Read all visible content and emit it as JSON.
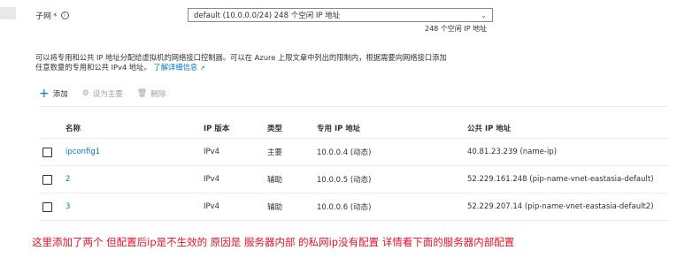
{
  "subnet": {
    "label": "子网",
    "required_mark": "*",
    "value": "default (10.0.0.0/24) 248 个空闲 IP 地址",
    "sub_text": "248 个空闲 IP 地址"
  },
  "description": {
    "line1": "可以将专用和公共 IP 地址分配给虚拟机的网络接口控制器。可以在 Azure 上限文章中列出的限制内，根据需要向网络接口添加",
    "line2": "任意数量的专用和公共 IPv4 地址。",
    "link": "了解详细信息"
  },
  "toolbar": {
    "add": "添加",
    "set_primary": "设为主要",
    "delete": "删除"
  },
  "table": {
    "headers": [
      "名称",
      "IP 版本",
      "类型",
      "专用 IP 地址",
      "公共 IP 地址"
    ],
    "rows": [
      {
        "name": "ipconfig1",
        "version": "IPv4",
        "type": "主要",
        "private": "10.0.0.4 (动态)",
        "public": "40.81.23.239 (name-ip)"
      },
      {
        "name": "2",
        "version": "IPv4",
        "type": "辅助",
        "private": "10.0.0.5 (动态)",
        "public": "52.229.161.248 (pip-name-vnet-eastasia-default)"
      },
      {
        "name": "3",
        "version": "IPv4",
        "type": "辅助",
        "private": "10.0.0.6 (动态)",
        "public": "52.229.207.14 (pip-name-vnet-eastasia-default2)"
      }
    ]
  },
  "annotation": "这里添加了两个   但配置后ip是不生效的 原因是 服务器内部 的私网ip没有配置  详情看下面的服务器内部配置",
  "colors": {
    "link": "#0078d4",
    "annotation": "#e81123"
  }
}
